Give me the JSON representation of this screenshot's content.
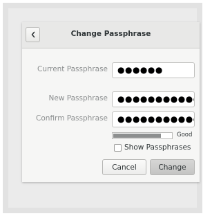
{
  "dialog": {
    "title": "Change Passphrase",
    "back_icon": "chevron-left-icon"
  },
  "form": {
    "current": {
      "label": "Current Passphrase",
      "value": "●●●●●●"
    },
    "new": {
      "label": "New Passphrase",
      "value": "●●●●●●●●●●●●"
    },
    "confirm": {
      "label": "Confirm Passphrase",
      "value": "●●●●●●●●●●●●"
    },
    "strength": {
      "level": 0.82,
      "label": "Good"
    },
    "show_passphrases": {
      "label": "Show Passphrases",
      "checked": false
    }
  },
  "buttons": {
    "cancel": "Cancel",
    "change": "Change"
  }
}
